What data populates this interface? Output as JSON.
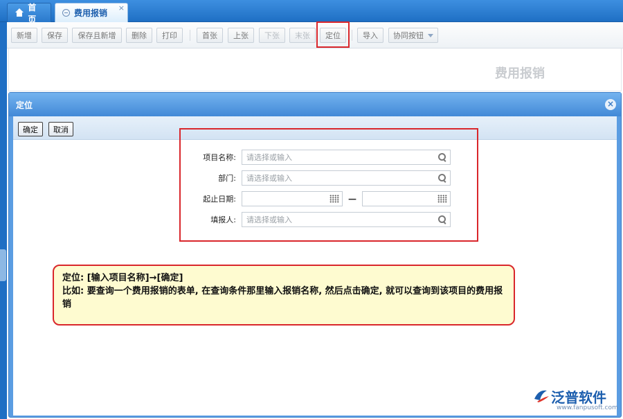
{
  "tabs": [
    {
      "label": "首页",
      "icon": "home-icon",
      "active": false
    },
    {
      "label": "费用报销",
      "icon": "document-icon",
      "active": true,
      "close": "×"
    }
  ],
  "toolbar": {
    "buttons": [
      {
        "label": "新增",
        "enabled": true
      },
      {
        "label": "保存",
        "enabled": true
      },
      {
        "label": "保存且新增",
        "enabled": true
      },
      {
        "label": "删除",
        "enabled": true
      },
      {
        "label": "打印",
        "enabled": true
      },
      {
        "label": "首张",
        "enabled": true
      },
      {
        "label": "上张",
        "enabled": true
      },
      {
        "label": "下张",
        "enabled": false
      },
      {
        "label": "末张",
        "enabled": false
      },
      {
        "label": "定位",
        "enabled": true,
        "highlighted": true
      },
      {
        "label": "导入",
        "enabled": true
      },
      {
        "label": "协同按钮",
        "enabled": true,
        "dropdown": true
      }
    ]
  },
  "document": {
    "title": "费用报销"
  },
  "dialog": {
    "title": "定位",
    "close": "×",
    "confirm_label": "确定",
    "cancel_label": "取消",
    "fields": {
      "project_name": {
        "label": "项目名称:",
        "placeholder": "请选择或输入",
        "icon": "search-icon"
      },
      "department": {
        "label": "部门:",
        "placeholder": "请选择或输入",
        "icon": "search-icon"
      },
      "date_range": {
        "label": "起止日期:",
        "separator": "—",
        "icon": "calendar-icon"
      },
      "reporter": {
        "label": "填报人:",
        "placeholder": "请选择或输入",
        "icon": "search-icon"
      }
    }
  },
  "note": {
    "line1": "定位: [输入项目名称]→[确定]",
    "line2": "比如: 要查询一个费用报销的表单, 在查询条件那里输入报销名称, 然后点击确定, 就可以查询到该项目的费用报销"
  },
  "logo": {
    "text": "泛普软件",
    "url": "www.fanpusoft.com"
  },
  "colors": {
    "highlight": "#d9262b",
    "brand": "#1d5fae",
    "dialog_header": "#4289d7",
    "note_bg": "#fefbd0"
  }
}
